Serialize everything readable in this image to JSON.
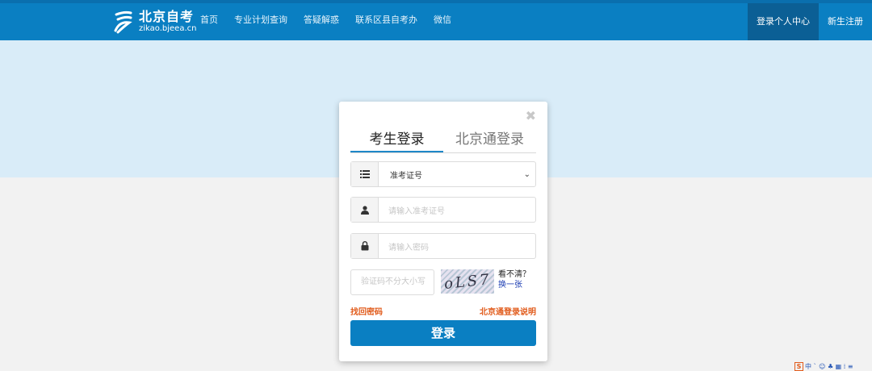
{
  "header": {
    "logo_title": "北京自考",
    "logo_sub": "zikao.bjeea.cn",
    "nav": [
      "首页",
      "专业计划查询",
      "答疑解惑",
      "联系区县自考办",
      "微信"
    ],
    "right": [
      "登录个人中心",
      "新生注册"
    ]
  },
  "modal": {
    "tabs": [
      "考生登录",
      "北京通登录"
    ],
    "select_value": "准考证号",
    "id_placeholder": "请输入准考证号",
    "pwd_placeholder": "请输入密码",
    "captcha_placeholder": "验证码不分大小写",
    "captcha_text": "oLS7",
    "cant_see": "看不清？",
    "change": "换一张",
    "forgot": "找回密码",
    "bjt_note": "北京通登录说明",
    "login": "登录"
  },
  "tray": {
    "s_label": "S",
    "items": "中 ˋ ☺ ♣ ▦ ⁞ ≡"
  },
  "colors": {
    "primary": "#0a7fc2",
    "accent_link": "#e15b1b",
    "hero": "#d9ecf8"
  }
}
